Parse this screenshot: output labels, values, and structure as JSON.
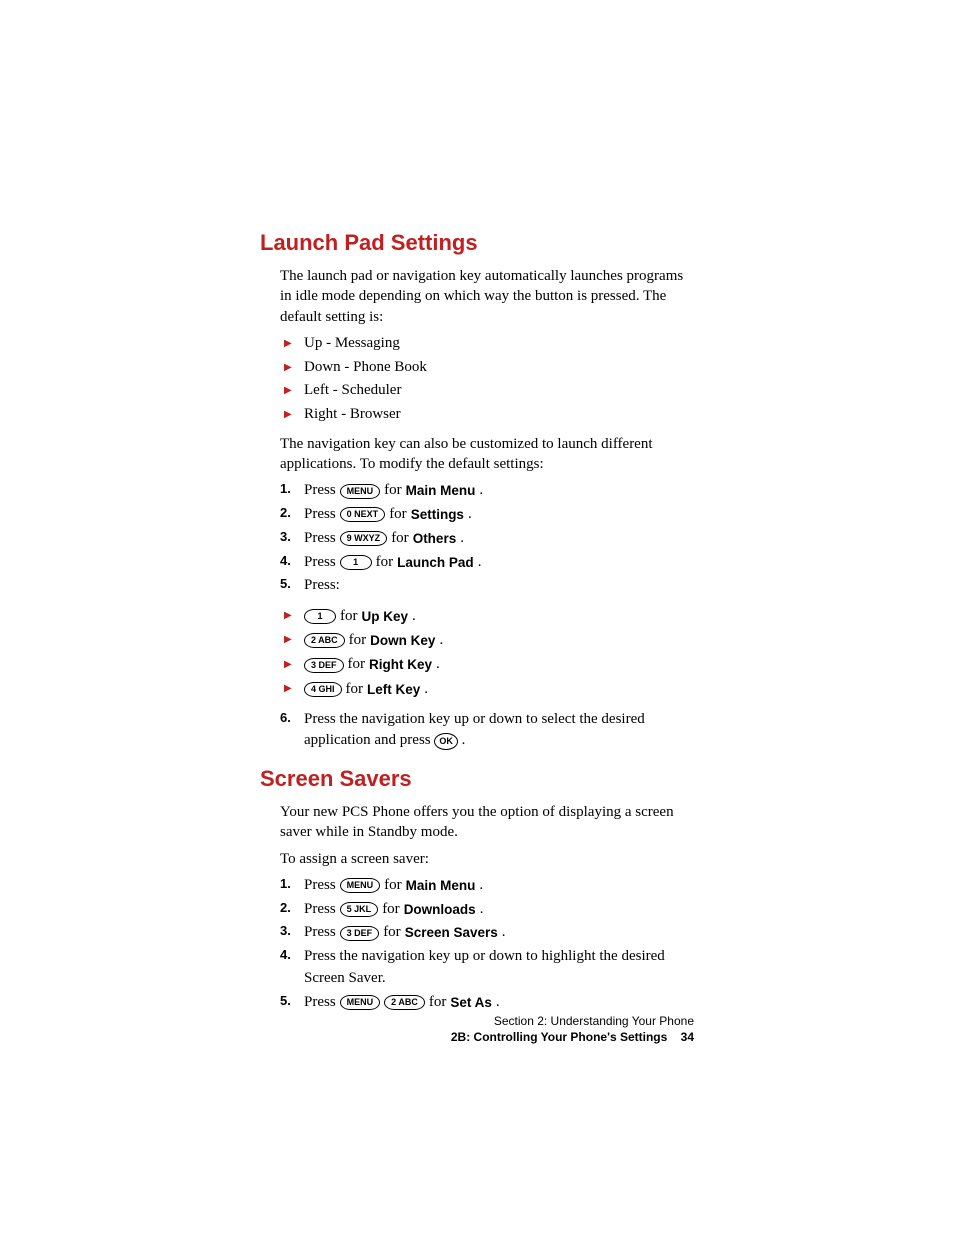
{
  "launch": {
    "heading": "Launch Pad Settings",
    "intro": "The launch pad or navigation key automatically launches programs in idle mode depending on which way the button is pressed. The default setting is:",
    "defaults": [
      "Up - Messaging",
      "Down - Phone Book",
      "Left - Scheduler",
      "Right - Browser"
    ],
    "custom_intro": "The navigation key can also be customized to launch different applications. To modify the default settings:",
    "steps": {
      "press_word": "Press ",
      "for_word": " for ",
      "s1": {
        "key": "MENU",
        "target": "Main Menu"
      },
      "s2": {
        "key": "0 NEXT",
        "target": "Settings"
      },
      "s3": {
        "key": "9 WXYZ",
        "target": "Others"
      },
      "s4": {
        "key": "1",
        "target": "Launch Pad"
      },
      "s5_label": "Press:",
      "dirs": [
        {
          "key": "1",
          "target": "Up Key"
        },
        {
          "key": "2 ABC",
          "target": "Down Key"
        },
        {
          "key": "3 DEF",
          "target": "Right Key"
        },
        {
          "key": "4 GHI",
          "target": "Left Key"
        }
      ],
      "s6_pre": "Press the navigation key up or down to select the desired application and press ",
      "s6_key": "OK",
      "s6_post": "."
    }
  },
  "screen": {
    "heading": "Screen Savers",
    "intro": "Your new PCS Phone offers you the option of displaying a screen saver while in Standby mode.",
    "assign_intro": "To assign a screen saver:",
    "steps": {
      "press_word": "Press ",
      "for_word": " for ",
      "s1": {
        "key": "MENU",
        "target": "Main Menu"
      },
      "s2": {
        "key": "5 JKL",
        "target": "Downloads"
      },
      "s3": {
        "key": "3 DEF",
        "target": "Screen Savers"
      },
      "s4": "Press the navigation key up or down to highlight the desired Screen Saver.",
      "s5_key1": "MENU",
      "s5_key2": "2 ABC",
      "s5_target": "Set As"
    }
  },
  "footer": {
    "line1": "Section 2: Understanding Your Phone",
    "line2": "2B: Controlling Your Phone's Settings",
    "page": "34"
  }
}
